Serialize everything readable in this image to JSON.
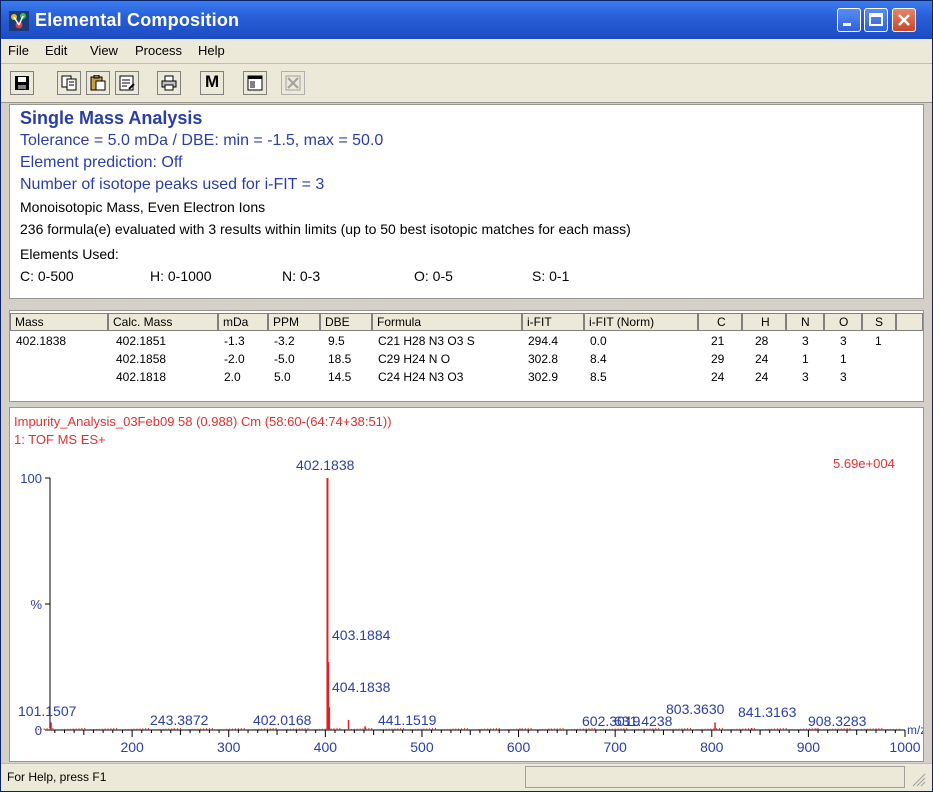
{
  "window": {
    "title": "Elemental Composition"
  },
  "menu": [
    "File",
    "Edit",
    "View",
    "Process",
    "Help"
  ],
  "toolbar": {
    "icons": [
      "save-icon",
      "copy-icon",
      "paste-icon",
      "properties-icon",
      "print-icon",
      "m-icon",
      "window-icon",
      "close-x-icon"
    ],
    "m_label": "M"
  },
  "summary": {
    "heading": "Single Mass Analysis",
    "tolerance": "Tolerance = 5.0 mDa   /   DBE: min = -1.5, max = 50.0",
    "prediction": "Element prediction: Off",
    "isotope": "Number of isotope peaks used for i-FIT = 3",
    "mass_type": "Monoisotopic Mass, Even Electron Ions",
    "evaluated": "236 formula(e) evaluated with 3 results within limits (up to 50 best isotopic matches for each mass)",
    "elements_label": "Elements Used:",
    "elements": [
      "C: 0-500",
      "H: 0-1000",
      "N: 0-3",
      "O: 0-5",
      "S: 0-1"
    ]
  },
  "table": {
    "headers": [
      "Mass",
      "Calc. Mass",
      "mDa",
      "PPM",
      "DBE",
      "Formula",
      "i-FIT",
      "i-FIT (Norm)",
      "C",
      "H",
      "N",
      "O",
      "S"
    ],
    "rows": [
      [
        "402.1838",
        "402.1851",
        "-1.3",
        "-3.2",
        "9.5",
        "C21  H28  N3  O3  S",
        "294.4",
        "0.0",
        "21",
        "28",
        "3",
        "3",
        "1"
      ],
      [
        "",
        "402.1858",
        "-2.0",
        "-5.0",
        "18.5",
        "C29  H24  N  O",
        "302.8",
        "8.4",
        "29",
        "24",
        "1",
        "1",
        ""
      ],
      [
        "",
        "402.1818",
        "2.0",
        "5.0",
        "14.5",
        "C24  H24  N3  O3",
        "302.9",
        "8.5",
        "24",
        "24",
        "3",
        "3",
        ""
      ]
    ]
  },
  "spectrum": {
    "header1": "Impurity_Analysis_03Feb09 58 (0.988) Cm (58:60-(64:74+38:51))",
    "header2": "1: TOF MS ES+",
    "scale": "5.69e+004",
    "y_top_label": "100",
    "y_mid_label": "%",
    "y_zero_label": "0",
    "x_unit": "m/z",
    "color": "#e02020",
    "chart_data": {
      "type": "bar",
      "xlim": [
        115,
        1000
      ],
      "ylim": [
        0,
        100
      ],
      "x_ticks": [
        "200",
        "300",
        "400",
        "500",
        "600",
        "700",
        "800",
        "900",
        "1000"
      ],
      "peaks": [
        {
          "x": 101.1507,
          "y": 3,
          "label": "101.1507"
        },
        {
          "x": 243.3872,
          "y": 0.5,
          "label": "243.3872"
        },
        {
          "x": 402.0168,
          "y": 0.5,
          "label": "402.0168"
        },
        {
          "x": 402.1838,
          "y": 100,
          "label": "402.1838"
        },
        {
          "x": 403.1884,
          "y": 27,
          "label": "403.1884"
        },
        {
          "x": 404.1838,
          "y": 9,
          "label": "404.1838"
        },
        {
          "x": 424.0,
          "y": 4,
          "label": ""
        },
        {
          "x": 441.1519,
          "y": 1.5,
          "label": "441.1519"
        },
        {
          "x": 602.3019,
          "y": 0.5,
          "label": "602.3019"
        },
        {
          "x": 631.4238,
          "y": 0.5,
          "label": "631.4238"
        },
        {
          "x": 803.363,
          "y": 3,
          "label": "803.3630"
        },
        {
          "x": 841.3163,
          "y": 0.8,
          "label": "841.3163"
        },
        {
          "x": 908.3283,
          "y": 0.5,
          "label": "908.3283"
        }
      ]
    }
  },
  "status": {
    "text": "For Help, press F1"
  }
}
